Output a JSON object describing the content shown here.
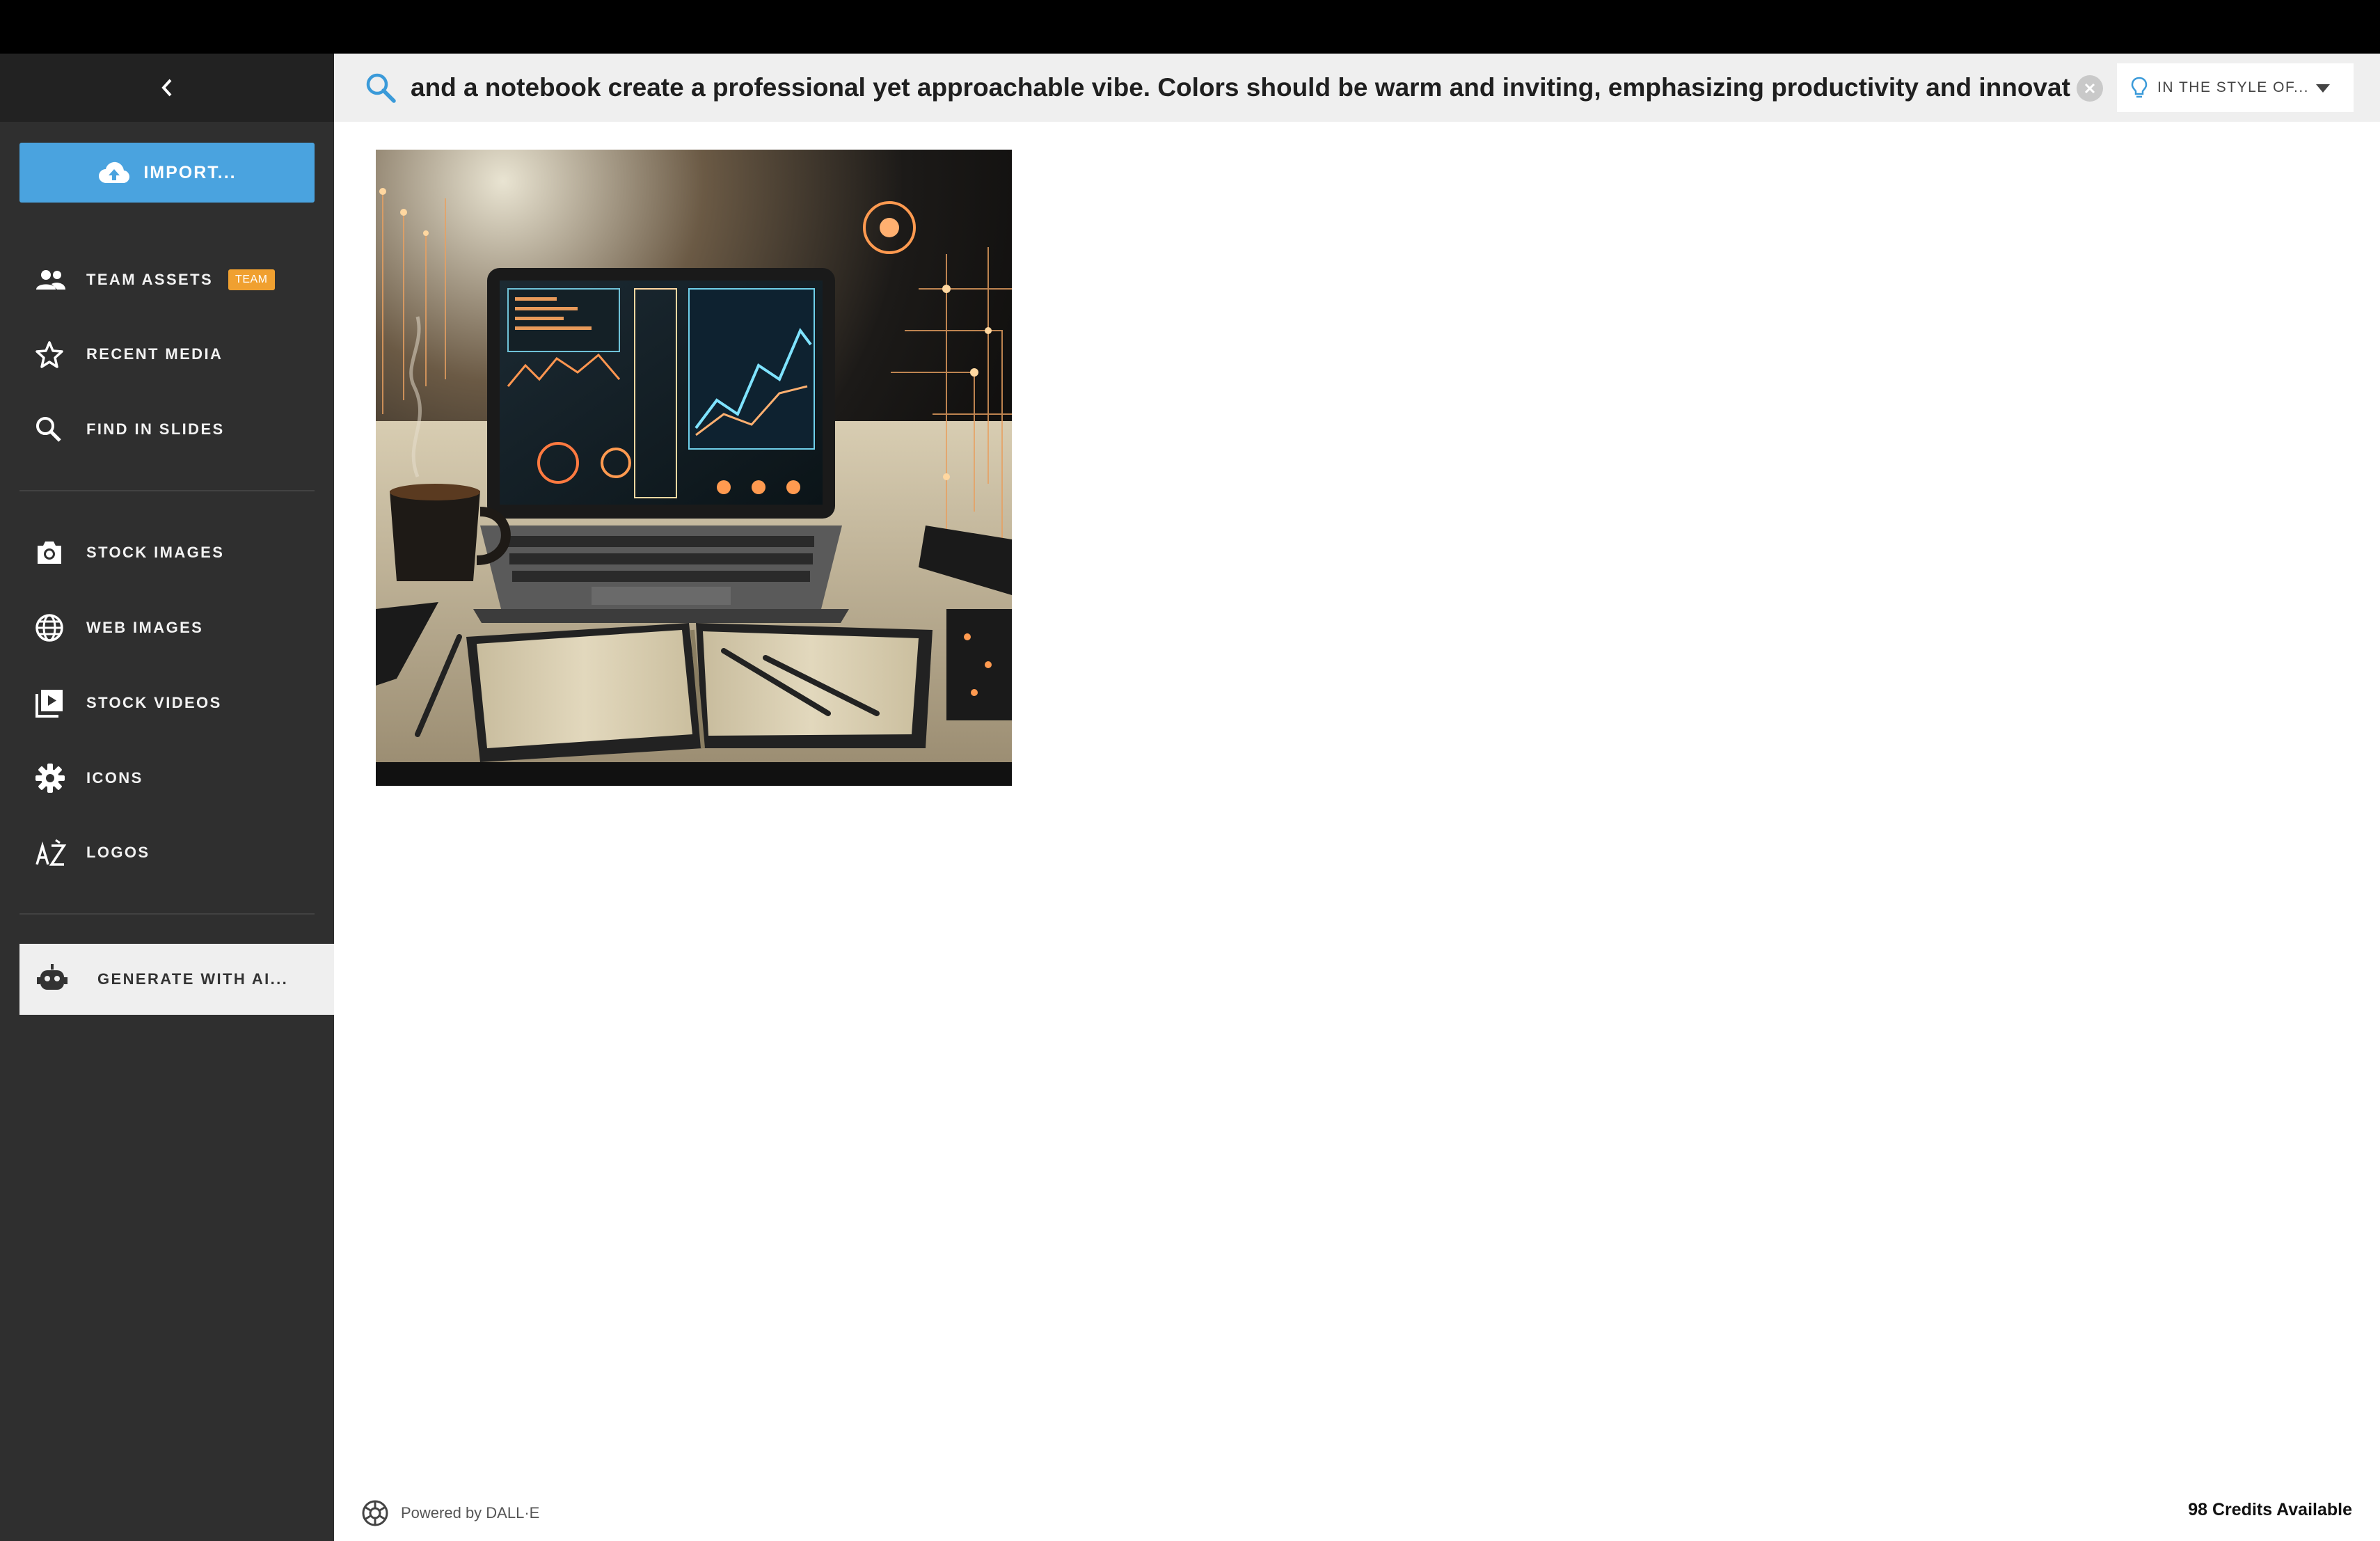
{
  "topbar": {},
  "sidebar": {
    "import_label": "IMPORT...",
    "items": [
      {
        "label": "TEAM ASSETS",
        "badge": "TEAM",
        "icon": "team-icon"
      },
      {
        "label": "RECENT MEDIA",
        "icon": "star-icon"
      },
      {
        "label": "FIND IN SLIDES",
        "icon": "search-icon"
      },
      {
        "label": "STOCK IMAGES",
        "icon": "camera-icon"
      },
      {
        "label": "WEB IMAGES",
        "icon": "globe-icon"
      },
      {
        "label": "STOCK VIDEOS",
        "icon": "video-icon"
      },
      {
        "label": "ICONS",
        "icon": "gear-icon"
      },
      {
        "label": "LOGOS",
        "icon": "logos-icon"
      }
    ],
    "generate_label": "GENERATE WITH AI..."
  },
  "search": {
    "value": "and a notebook create a professional yet approachable vibe. Colors should be warm and inviting, emphasizing productivity and innovation.\"",
    "style_label": "IN THE STYLE OF..."
  },
  "footer": {
    "powered_by": "Powered by DALL·E",
    "credits": "98 Credits Available"
  },
  "colors": {
    "sidebar_bg": "#2f2f2f",
    "accent": "#4aa3df",
    "badge": "#f0a030"
  }
}
